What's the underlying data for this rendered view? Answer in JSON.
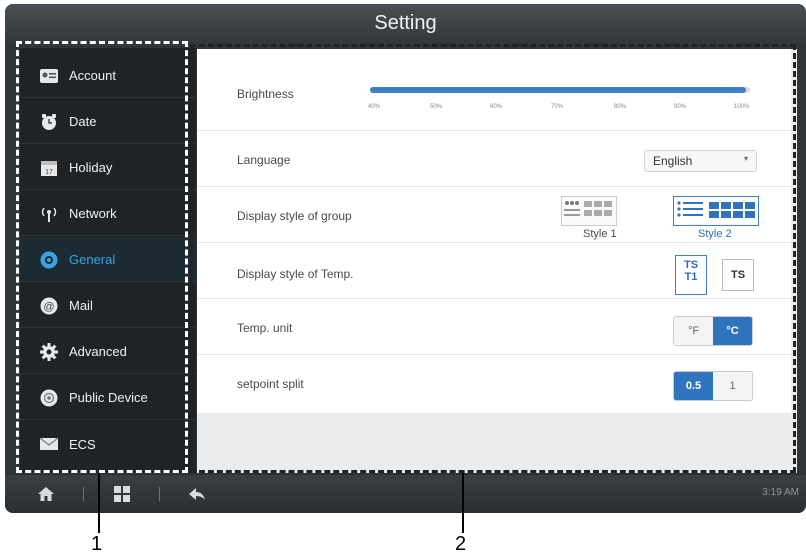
{
  "window": {
    "title": "Setting"
  },
  "sidebar": {
    "items": [
      {
        "label": "Account",
        "icon": "account-card-icon",
        "active": false
      },
      {
        "label": "Date",
        "icon": "clock-icon",
        "active": false
      },
      {
        "label": "Holiday",
        "icon": "calendar-icon",
        "active": false
      },
      {
        "label": "Network",
        "icon": "wireless-network-icon",
        "active": false
      },
      {
        "label": "General",
        "icon": "general-gear-icon",
        "active": true
      },
      {
        "label": "Mail",
        "icon": "at-mail-icon",
        "active": false
      },
      {
        "label": "Advanced",
        "icon": "advanced-gear-icon",
        "active": false
      },
      {
        "label": "Public Device",
        "icon": "public-device-icon",
        "active": false
      },
      {
        "label": "ECS",
        "icon": "envelope-icon",
        "active": false
      }
    ]
  },
  "general": {
    "brightness": {
      "label": "Brightness",
      "value_percent": 99,
      "ticks": [
        "40%",
        "50%",
        "60%",
        "70%",
        "80%",
        "90%",
        "100%"
      ]
    },
    "language": {
      "label": "Language",
      "selected": "English",
      "arrow": "▾"
    },
    "group_style": {
      "label": "Display style of group",
      "option1": "Style 1",
      "option2": "Style 2",
      "selected": "Style 2"
    },
    "temp_style": {
      "label": "Display style of Temp.",
      "option1_line1": "TS",
      "option1_line2": "T1",
      "option2": "TS"
    },
    "temp_unit": {
      "label": "Temp. unit",
      "option_f": "°F",
      "option_c": "°C",
      "selected": "°C"
    },
    "setpoint_split": {
      "label": "setpoint split",
      "option1": "0.5",
      "option2": "1",
      "selected": "0.5"
    }
  },
  "bottombar": {
    "time": "3:19 AM"
  },
  "callouts": {
    "one": "1",
    "two": "2"
  },
  "colors": {
    "accent": "#2f74bd",
    "active_text": "#3aa3e0"
  }
}
